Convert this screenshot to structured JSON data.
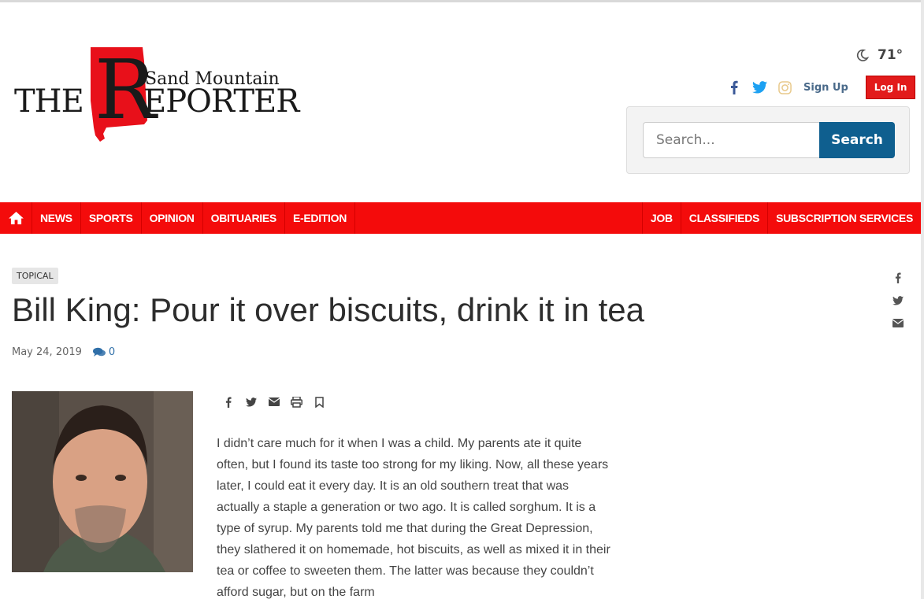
{
  "logo": {
    "the": "THE",
    "r": "R",
    "eporter": "EPORTER",
    "sand_mountain": "Sand Mountain"
  },
  "weather": {
    "temp": "71°",
    "icon": "moon-icon"
  },
  "account": {
    "signup": "Sign Up",
    "login": "Log In"
  },
  "social": [
    "facebook-icon",
    "twitter-icon",
    "instagram-icon"
  ],
  "search": {
    "placeholder": "Search...",
    "button": "Search"
  },
  "nav": {
    "left": [
      "NEWS",
      "SPORTS",
      "OPINION",
      "OBITUARIES",
      "E-EDITION"
    ],
    "right": [
      "JOB",
      "CLASSIFIEDS",
      "SUBSCRIPTION SERVICES"
    ]
  },
  "article": {
    "tag": "TOPICAL",
    "headline": "Bill King: Pour it over biscuits, drink it in tea",
    "date": "May 24, 2019",
    "comments": "0",
    "body": "I didn’t care much for it when I was a child. My parents ate it quite often, but I found its taste too strong for my liking. Now, all these years later, I could eat it every day. It is an old southern treat that was actually a staple a generation or two ago. It is called sorghum. It is a type of syrup. My parents told me that during the Great Depression, they slathered it on homemade, hot biscuits, as well as mixed it in their tea or coffee to sweeten them. The latter was because they couldn’t afford sugar, but on the farm"
  },
  "colors": {
    "brand_red": "#f40b0b",
    "search_blue": "#0f5f8f",
    "login_red": "#e21b1b"
  }
}
